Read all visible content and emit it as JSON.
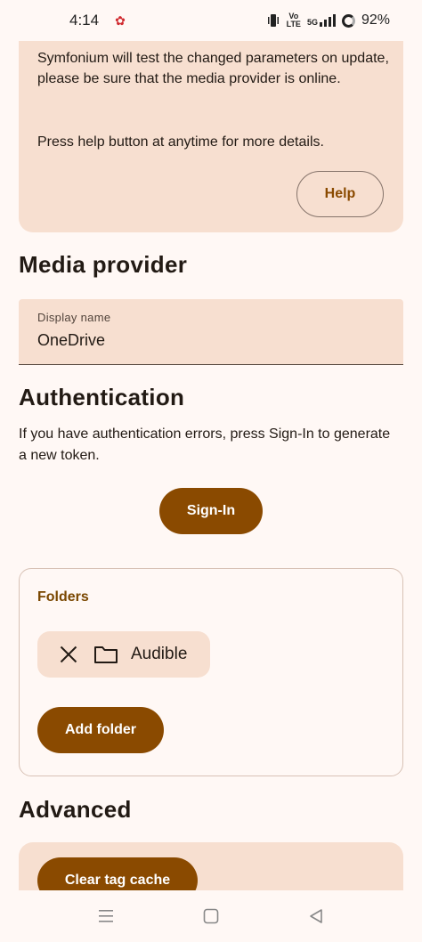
{
  "status_bar": {
    "time": "4:14",
    "notification_icon": "app-notification-icon",
    "network_label_top": "Vo",
    "network_label_bottom": "LTE",
    "network_type": "5G",
    "battery": "92%"
  },
  "info_card": {
    "text_1": "Symfonium will test the changed parameters on update, please be sure that the media provider is online.",
    "text_2": "Press help button at anytime for more details.",
    "help_label": "Help"
  },
  "media_provider": {
    "title": "Media provider",
    "display_name_label": "Display name",
    "display_name_value": "OneDrive"
  },
  "authentication": {
    "title": "Authentication",
    "description": "If you have authentication errors, press Sign-In to generate a new token.",
    "sign_in_label": "Sign-In"
  },
  "folders": {
    "title": "Folders",
    "items": [
      {
        "label": "Audible"
      }
    ],
    "add_label": "Add folder"
  },
  "advanced": {
    "title": "Advanced",
    "clear_cache_label": "Clear tag cache"
  },
  "colors": {
    "primary": "#8a4a00",
    "surface": "#fff8f5",
    "container": "#f7dfd0",
    "outline": "#d8c2b6"
  },
  "nav_icons": [
    "menu-icon",
    "home-square-icon",
    "back-triangle-icon"
  ]
}
